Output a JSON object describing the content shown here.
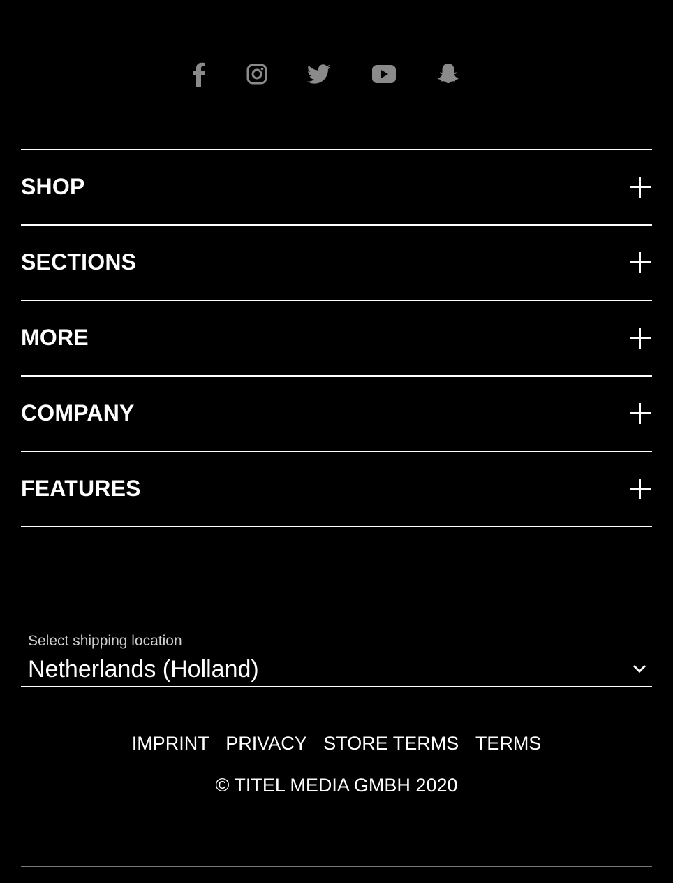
{
  "social": {
    "icons": [
      "facebook-icon",
      "instagram-icon",
      "twitter-icon",
      "youtube-icon",
      "snapchat-icon"
    ],
    "icon_color": "#8a8a8a"
  },
  "accordion": {
    "items": [
      {
        "label": "SHOP"
      },
      {
        "label": "SECTIONS"
      },
      {
        "label": "MORE"
      },
      {
        "label": "COMPANY"
      },
      {
        "label": "FEATURES"
      }
    ],
    "expand_icon": "plus-icon"
  },
  "shipping": {
    "label": "Select shipping location",
    "value": "Netherlands (Holland)",
    "chevron_icon": "chevron-down-icon"
  },
  "legal_links": {
    "imprint": "IMPRINT",
    "privacy": "PRIVACY",
    "store_terms": "STORE TERMS",
    "terms": "TERMS"
  },
  "copyright": "© TITEL MEDIA GMBH 2020",
  "colors": {
    "background": "#000000",
    "text": "#ffffff",
    "divider": "#ffffff"
  }
}
